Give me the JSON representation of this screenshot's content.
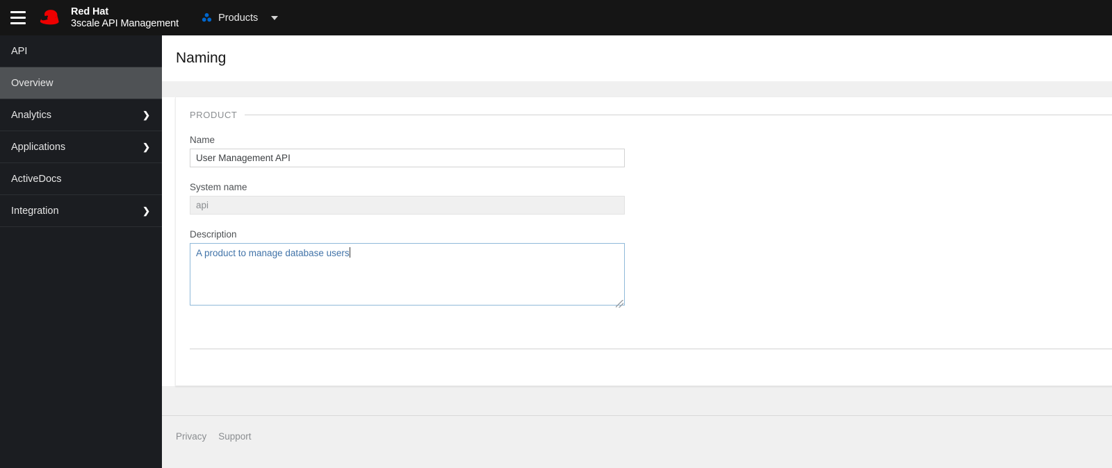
{
  "masthead": {
    "hamburger_icon": "hamburger-menu-icon",
    "logo_icon": "red-hat-fedora-logo-icon",
    "brand_line1": "Red Hat",
    "brand_line2": "3scale API Management",
    "context_switcher": {
      "icon": "cluster-cubes-icon",
      "label": "Products",
      "caret_icon": "chevron-down-icon"
    },
    "background_color": "#151515"
  },
  "sidebar": {
    "background_color": "#1b1d21",
    "active_color": "#4f5255",
    "items": [
      {
        "label": "API",
        "has_chevron": false,
        "active": false
      },
      {
        "label": "Overview",
        "has_chevron": false,
        "active": true
      },
      {
        "label": "Analytics",
        "has_chevron": true,
        "active": false
      },
      {
        "label": "Applications",
        "has_chevron": true,
        "active": false
      },
      {
        "label": "ActiveDocs",
        "has_chevron": false,
        "active": false
      },
      {
        "label": "Integration",
        "has_chevron": true,
        "active": false
      }
    ],
    "chevron_glyph": "❯"
  },
  "main": {
    "page_title": "Naming",
    "fieldset": {
      "legend": "PRODUCT",
      "fields": [
        {
          "label": "Name",
          "value": "User Management API",
          "placeholder": "",
          "type": "text",
          "disabled": false
        },
        {
          "label": "System name",
          "value": "api",
          "placeholder": "api",
          "type": "text",
          "disabled": true
        },
        {
          "label": "Description",
          "value": "A product to manage database users",
          "placeholder": "",
          "type": "textarea",
          "disabled": false,
          "focused": true
        }
      ]
    }
  },
  "footer": {
    "links": [
      {
        "label": "Privacy"
      },
      {
        "label": "Support"
      }
    ]
  }
}
